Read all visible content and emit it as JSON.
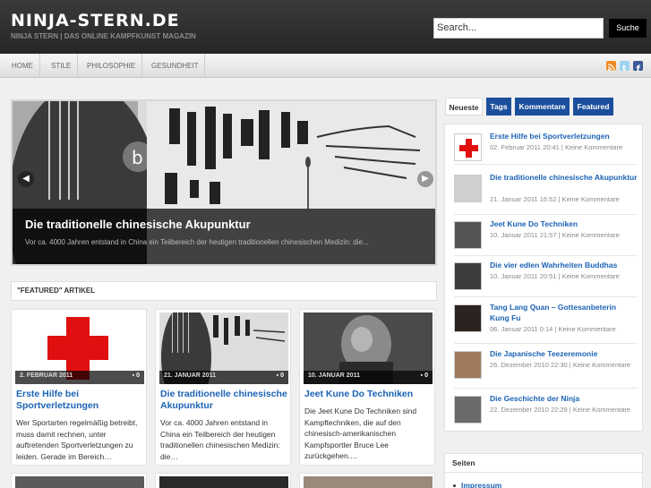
{
  "header": {
    "site_title": "NINJA-STERN.DE",
    "tagline": "NINJA STERN | DAS ONLINE KAMPFKUNST MAGAZIN",
    "search_value": "Search...",
    "search_button": "Suche"
  },
  "nav": {
    "items": [
      "HOME",
      "STILE",
      "PHILOSOPHIE",
      "GESUNDHEIT"
    ],
    "social_icons": [
      "rss-icon",
      "twitter-icon",
      "facebook-icon"
    ]
  },
  "slider": {
    "title": "Die traditionelle chinesische Akupunktur",
    "excerpt": "Vor ca. 4000 Jahren entstand in China ein Teilbereich der heutigen traditionellen chinesischen Medizin: die...",
    "overlay_letter": "b"
  },
  "featured": {
    "heading": "\"FEATURED\" ARTIKEL",
    "cards": [
      {
        "date": "2. FEBRUAR 2011",
        "comments": "0",
        "title": "Erste Hilfe bei Sportverletzungen",
        "excerpt": "Wer Sportarten regelmäßig betreibt, muss damit rechnen, unter auftretenden Sportverletzungen zu leiden. Gerade im Bereich…"
      },
      {
        "date": "21. JANUAR 2011",
        "comments": "0",
        "title": "Die traditionelle chinesische Akupunktur",
        "excerpt": "Vor ca. 4000 Jahren entstand in China ein Teilbereich der heutigen traditionellen chinesischen Medizin: die…"
      },
      {
        "date": "10. JANUAR 2011",
        "comments": "0",
        "title": "Jeet Kune Do Techniken",
        "excerpt": "Die Jeet Kune Do Techniken sind Kampftechniken, die auf den chinesisch-amerikanischen Kampfsportler Bruce Lee zurückgehen.…"
      }
    ]
  },
  "sidebar": {
    "tabs": [
      "Neueste",
      "Tags",
      "Kommentare",
      "Featured"
    ],
    "active_tab": "Neueste",
    "items": [
      {
        "title": "Erste Hilfe bei Sportverletzungen",
        "meta": "02. Februar 2011 20:41 | Keine Kommentare"
      },
      {
        "title": "Die traditionelle chinesische Akupunktur",
        "meta": "21. Januar 2011 16:52 | Keine Kommentare"
      },
      {
        "title": "Jeet Kune Do Techniken",
        "meta": "10. Januar 2011 21:57 | Keine Kommentare"
      },
      {
        "title": "Die vier edlen Wahrheiten Buddhas",
        "meta": "10. Januar 2011 20:51 | Keine Kommentare"
      },
      {
        "title": "Tang Lang Quan – Gottesanbeterin Kung Fu",
        "meta": "06. Januar 2011 0:14 | Keine Kommentare"
      },
      {
        "title": "Die Japanische Teezeremonie",
        "meta": "26. Dezember 2010 22:30 | Keine Kommentare"
      },
      {
        "title": "Die Geschichte der Ninja",
        "meta": "22. Dezember 2010 22:29 | Keine Kommentare"
      }
    ],
    "pages_heading": "Seiten",
    "pages_items": [
      "Impressum"
    ]
  },
  "colors": {
    "link_blue": "#1b63b5",
    "tab_blue": "#1b4f9c",
    "header_dark": "#2b2b2b",
    "red_cross": "#e01010"
  }
}
